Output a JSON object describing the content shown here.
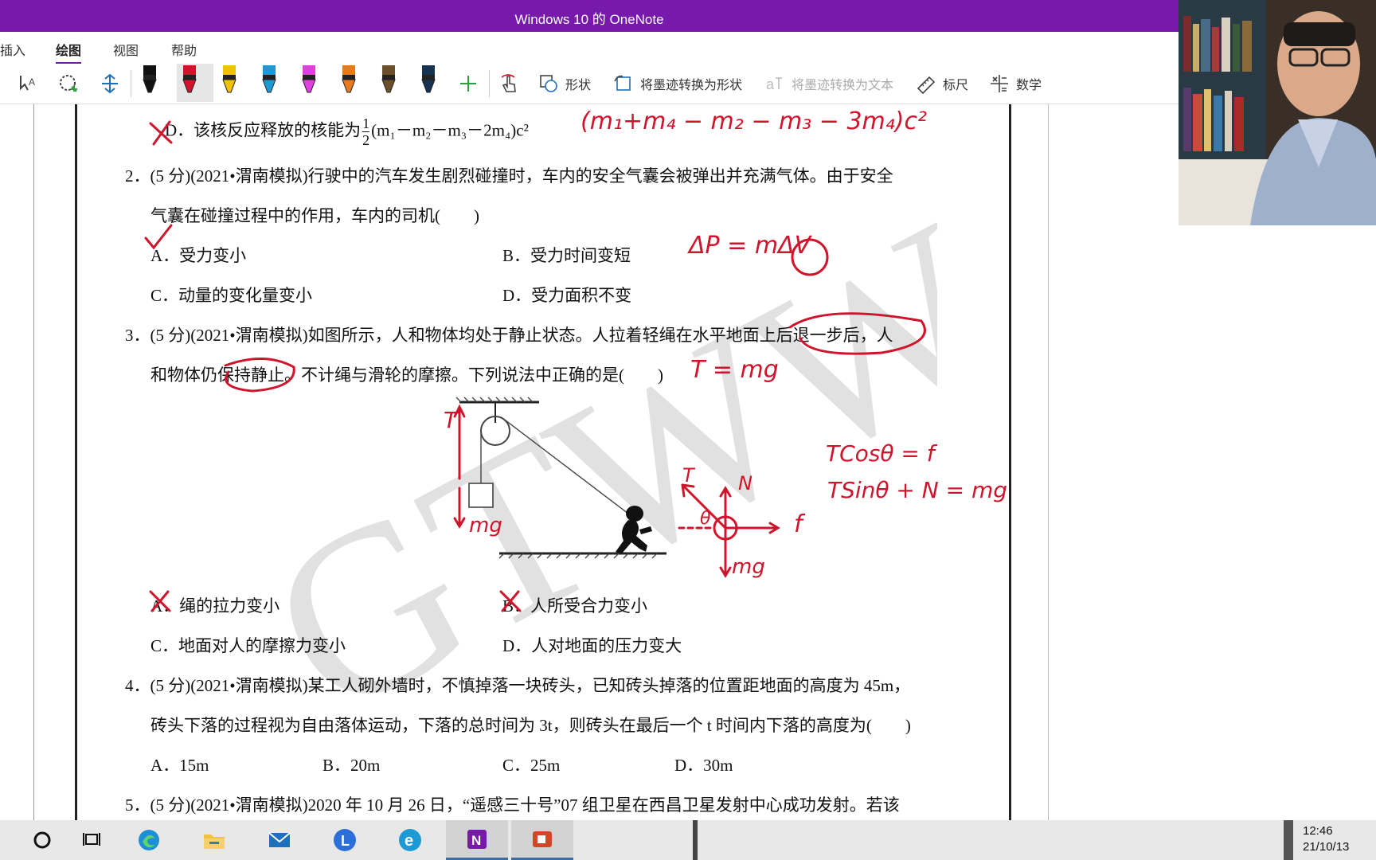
{
  "window": {
    "title": "Windows 10 的 OneNote",
    "accent": "#7719aa"
  },
  "menu": {
    "tabs": [
      "插入",
      "绘图",
      "视图",
      "帮助"
    ],
    "active": "绘图"
  },
  "ribbon": {
    "shapes": "形状",
    "ink_to_shape": "将墨迹转换为形状",
    "ink_to_text": "将墨迹转换为文本",
    "ruler": "标尺",
    "math": "数学",
    "pen_colors": [
      "#111111",
      "#d0142c",
      "#f2c200",
      "#1c9ad6",
      "#e040e0",
      "#e87a1e",
      "#6b4e2a",
      "#15324f"
    ]
  },
  "document": {
    "q1_opt_d": "D．该核反应释放的核能为",
    "q1_opt_d_formula": "(m₁－m₂－m₃－2m₄)c²",
    "q2_line1": "2．(5 分)(2021•渭南模拟)行驶中的汽车发生剧烈碰撞时，车内的安全气囊会被弹出并充满气体。由于安全",
    "q2_line2": "气囊在碰撞过程中的作用，车内的司机(　　)",
    "q2_a": "A．受力变小",
    "q2_b": "B．受力时间变短",
    "q2_c": "C．动量的变化量变小",
    "q2_d": "D．受力面积不变",
    "q3_line1": "3．(5 分)(2021•渭南模拟)如图所示，人和物体均处于静止状态。人拉着轻绳在水平地面上后退一步后，人",
    "q3_line2": "和物体仍保持静止。不计绳与滑轮的摩擦。下列说法中正确的是(　　)",
    "q3_a": "A．绳的拉力变小",
    "q3_b": "B．人所受合力变小",
    "q3_c": "C．地面对人的摩擦力变小",
    "q3_d": "D．人对地面的压力变大",
    "q4_line1": "4．(5 分)(2021•渭南模拟)某工人砌外墙时，不慎掉落一块砖头，已知砖头掉落的位置距地面的高度为 45m，",
    "q4_line2": "砖头下落的过程视为自由落体运动，下落的总时间为 3t，则砖头在最后一个 t 时间内下落的高度为(　　)",
    "q4_a": "A．15m",
    "q4_b": "B．20m",
    "q4_c": "C．25m",
    "q4_d": "D．30m",
    "q5_line1": "5．(5 分)(2021•渭南模拟)2020 年 10 月 26 日，“遥感三十号”07 组卫星在西昌卫星发射中心成功发射。若该",
    "watermark": "GTWWL"
  },
  "ink": {
    "formula_top": "(m₁+m₄ − m₂ − m₃ − 3m₄)c²",
    "momentum": "ΔP = mΔV",
    "tension": "T = mg",
    "eq1": "TCosθ = f",
    "eq2": "TSinθ + N = mg",
    "label_T": "T",
    "label_mg": "mg",
    "label_N": "N",
    "label_f": "f",
    "label_theta": "θ",
    "ink_color": "#d0142c"
  },
  "taskbar": {
    "time": "12:46",
    "date": "21/10/13"
  }
}
